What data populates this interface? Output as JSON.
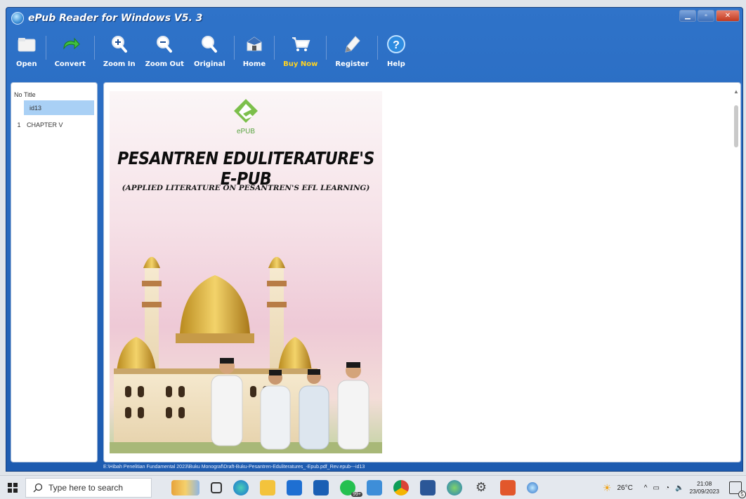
{
  "window": {
    "title": "ePub Reader for Windows V5. 3"
  },
  "toolbar": {
    "items": [
      {
        "label": "Open",
        "icon": "folder-icon"
      },
      {
        "label": "Convert",
        "icon": "convert-arrow-icon"
      },
      {
        "label": "Zoom In",
        "icon": "zoom-in-icon"
      },
      {
        "label": "Zoom Out",
        "icon": "zoom-out-icon"
      },
      {
        "label": "Original",
        "icon": "magnifier-icon"
      },
      {
        "label": "Home",
        "icon": "home-icon"
      },
      {
        "label": "Buy Now",
        "icon": "cart-icon"
      },
      {
        "label": "Register",
        "icon": "pen-icon"
      },
      {
        "label": "Help",
        "icon": "help-icon"
      }
    ]
  },
  "sidebar": {
    "col_no": "No",
    "col_title": "Title",
    "rows": [
      {
        "no": "",
        "title": "id13",
        "selected": true
      },
      {
        "no": "1",
        "title": "CHAPTER V",
        "selected": false
      }
    ]
  },
  "cover": {
    "logo_text": "ePUB",
    "title": "PESANTREN EDULITERATURE'S E-PUB",
    "subtitle": "(APPLIED LITERATURE ON PESANTREN'S EFL LEARNING)"
  },
  "status": {
    "path": "E:\\Hibah Penelitian Fundamental 2023\\Buku Monograf\\Draft-Buku-Pesantren-Eduliteratures_-Epub.pdf_Rev.epub---id13"
  },
  "taskbar": {
    "search_placeholder": "Type here to search",
    "weather": "26°C",
    "time": "21:08",
    "date": "23/09/2023",
    "notification_count": "5",
    "badge": "99+"
  }
}
